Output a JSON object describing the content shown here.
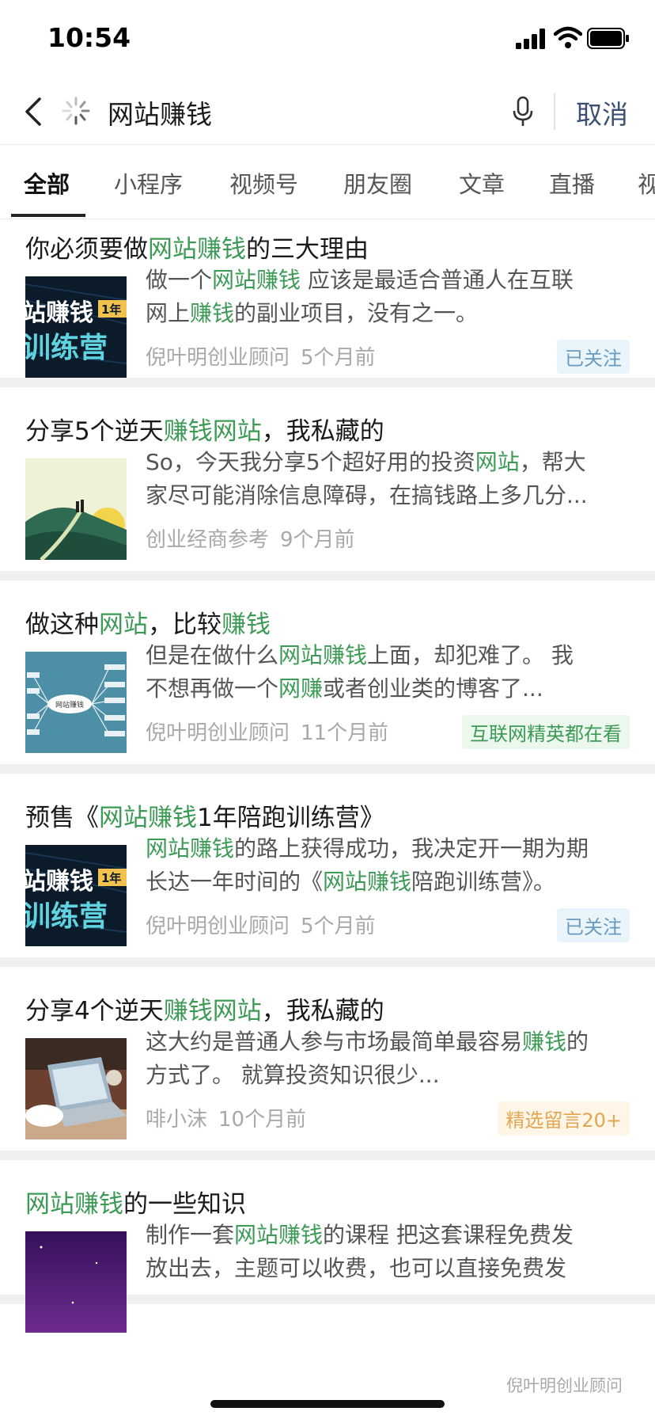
{
  "status_bar": {
    "time": "10:54"
  },
  "search": {
    "query": "网站赚钱",
    "cancel_label": "取消"
  },
  "tabs": [
    {
      "label": "全部"
    },
    {
      "label": "小程序"
    },
    {
      "label": "视频号"
    },
    {
      "label": "朋友圈"
    },
    {
      "label": "文章"
    },
    {
      "label": "直播"
    },
    {
      "label": "视"
    }
  ],
  "results": [
    {
      "title": [
        {
          "t": "你必须要做"
        },
        {
          "t": "网站赚钱",
          "hl": true
        },
        {
          "t": "的三大理由"
        }
      ],
      "thumb": "thumb-camp",
      "snippet": [
        [
          {
            "t": "做一个"
          },
          {
            "t": "网站赚钱",
            "hl": true
          },
          {
            "t": " 应该是最适合普通人在互联"
          }
        ],
        [
          {
            "t": "网上"
          },
          {
            "t": "赚钱",
            "hl": true
          },
          {
            "t": "的副业项目，没有之一。"
          }
        ]
      ],
      "source": "倪叶明创业顾问",
      "time": "5个月前",
      "tag": "已关注",
      "tag_type": "follow"
    },
    {
      "title": [
        {
          "t": "分享5个逆天"
        },
        {
          "t": "赚钱网站",
          "hl": true
        },
        {
          "t": "，我私藏的"
        }
      ],
      "thumb": "thumb-landscape",
      "snippet": [
        [
          {
            "t": "So，今天我分享5个超好用的投资"
          },
          {
            "t": "网站",
            "hl": true
          },
          {
            "t": "，帮大"
          }
        ],
        [
          {
            "t": "家尽可能消除信息障碍，在搞钱路上多几分..."
          }
        ]
      ],
      "source": "创业经商参考",
      "time": "9个月前",
      "tag": "",
      "tag_type": ""
    },
    {
      "title": [
        {
          "t": "做这种"
        },
        {
          "t": "网站",
          "hl": true
        },
        {
          "t": "，比较"
        },
        {
          "t": "赚钱",
          "hl": true
        }
      ],
      "thumb": "thumb-mindmap",
      "snippet": [
        [
          {
            "t": "但是在做什么"
          },
          {
            "t": "网站赚钱",
            "hl": true
          },
          {
            "t": "上面，却犯难了。 我"
          }
        ],
        [
          {
            "t": "不想再做一个"
          },
          {
            "t": "网赚",
            "hl": true
          },
          {
            "t": "或者创业类的博客了..."
          }
        ]
      ],
      "source": "倪叶明创业顾问",
      "time": "11个月前",
      "tag": "互联网精英都在看",
      "tag_type": "elite"
    },
    {
      "title": [
        {
          "t": "预售《"
        },
        {
          "t": "网站赚钱",
          "hl": true
        },
        {
          "t": "1年陪跑训练营》"
        }
      ],
      "thumb": "thumb-camp",
      "snippet": [
        [
          {
            "t": "网站赚钱",
            "hl": true
          },
          {
            "t": "的路上获得成功，我决定开一期为期"
          }
        ],
        [
          {
            "t": "长达一年时间的《"
          },
          {
            "t": "网站赚钱",
            "hl": true
          },
          {
            "t": "陪跑训练营》。"
          }
        ]
      ],
      "source": "倪叶明创业顾问",
      "time": "5个月前",
      "tag": "已关注",
      "tag_type": "follow"
    },
    {
      "title": [
        {
          "t": "分享4个逆天"
        },
        {
          "t": "赚钱网站",
          "hl": true
        },
        {
          "t": "，我私藏的"
        }
      ],
      "thumb": "thumb-laptop",
      "snippet": [
        [
          {
            "t": "这大约是普通人参与市场最简单最容易"
          },
          {
            "t": "赚钱",
            "hl": true
          },
          {
            "t": "的"
          }
        ],
        [
          {
            "t": "方式了。 就算投资知识很少..."
          }
        ]
      ],
      "source": "啡小沫",
      "time": "10个月前",
      "tag": "精选留言20+",
      "tag_type": "comments"
    },
    {
      "title": [
        {
          "t": "网站赚钱",
          "hl": true
        },
        {
          "t": "的一些知识"
        }
      ],
      "thumb": "thumb-purple",
      "snippet": [
        [
          {
            "t": "制作一套"
          },
          {
            "t": "网站赚钱",
            "hl": true
          },
          {
            "t": "的课程 把这套课程免费发"
          }
        ],
        [
          {
            "t": "放出去，主题可以收费，也可以直接免费发"
          }
        ]
      ],
      "source": "",
      "time": "",
      "tag": "",
      "tag_type": ""
    }
  ],
  "thumb_text": {
    "camp_line1": "站赚钱",
    "camp_badge": "1年",
    "camp_line2": "训练营",
    "mindmap_center": "网站赚钱"
  },
  "watermark": "倪叶明创业顾问",
  "colors": {
    "highlight": "#3c9a55",
    "cancel": "#3b4f74",
    "meta": "#a8a8a8"
  }
}
